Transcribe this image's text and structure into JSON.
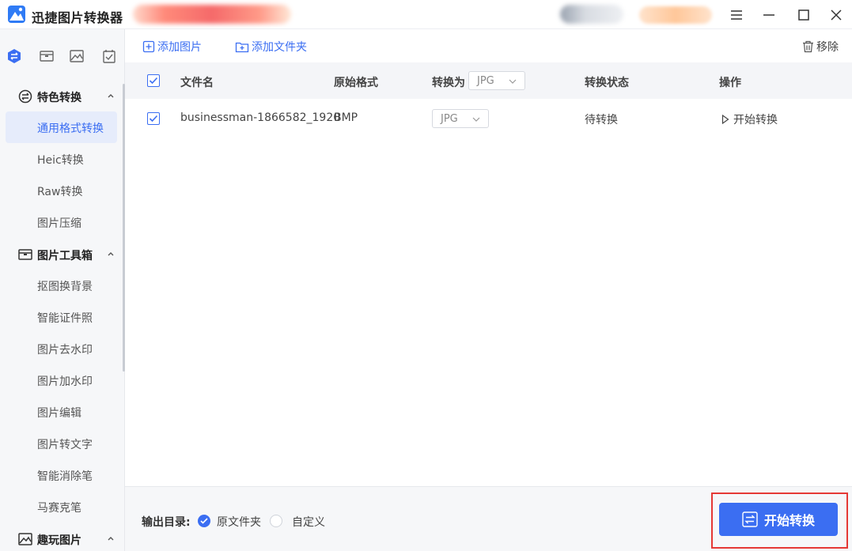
{
  "app": {
    "title": "迅捷图片转换器",
    "accent": "#3b6ef2"
  },
  "window": {
    "menu_icon": "hamburger-icon",
    "minimize_icon": "minimize-icon",
    "maximize_icon": "maximize-icon",
    "close_icon": "close-icon"
  },
  "sidebar": {
    "sections": [
      {
        "label": "特色转换",
        "icon": "convert-icon",
        "expanded": true,
        "items": [
          {
            "label": "通用格式转换",
            "active": true
          },
          {
            "label": "Heic转换"
          },
          {
            "label": "Raw转换"
          },
          {
            "label": "图片压缩"
          }
        ]
      },
      {
        "label": "图片工具箱",
        "icon": "toolbox-icon",
        "expanded": true,
        "items": [
          {
            "label": "抠图换背景"
          },
          {
            "label": "智能证件照"
          },
          {
            "label": "图片去水印"
          },
          {
            "label": "图片加水印"
          },
          {
            "label": "图片编辑"
          },
          {
            "label": "图片转文字"
          },
          {
            "label": "智能消除笔"
          },
          {
            "label": "马赛克笔"
          }
        ]
      },
      {
        "label": "趣玩图片",
        "icon": "fun-image-icon",
        "expanded": true,
        "items": []
      }
    ]
  },
  "toolbar": {
    "add_image": "添加图片",
    "add_folder": "添加文件夹",
    "remove": "移除"
  },
  "table": {
    "headers": {
      "filename": "文件名",
      "original_format": "原始格式",
      "convert_to": "转换为",
      "status": "转换状态",
      "action": "操作"
    },
    "header_format_value": "JPG",
    "rows": [
      {
        "checked": true,
        "filename": "businessman-1866582_1920",
        "original_format": "BMP",
        "convert_to": "JPG",
        "status": "待转换",
        "action": "开始转换"
      }
    ]
  },
  "footer": {
    "output_label": "输出目录:",
    "options": [
      {
        "label": "原文件夹",
        "selected": true
      },
      {
        "label": "自定义",
        "selected": false
      }
    ],
    "convert_button": "开始转换"
  }
}
